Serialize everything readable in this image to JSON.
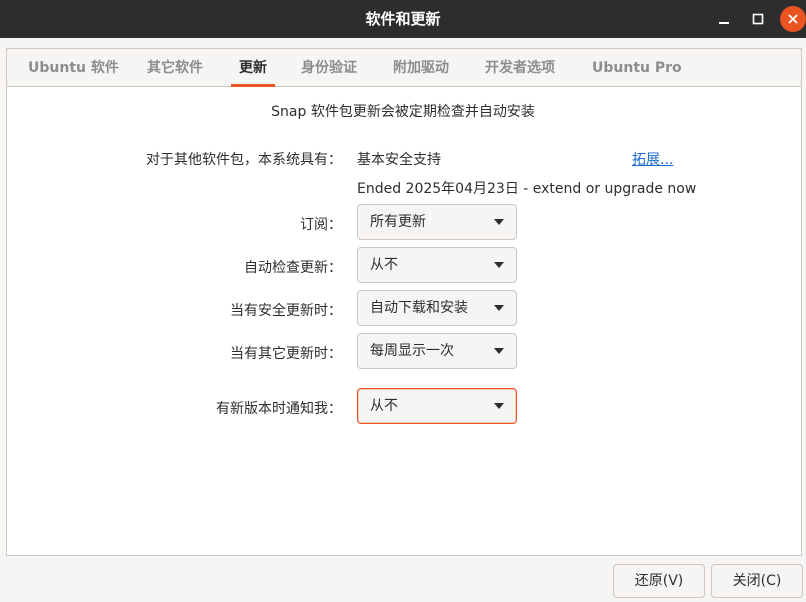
{
  "window": {
    "title": "软件和更新",
    "minimize_icon": "minimize-icon",
    "maximize_icon": "maximize-icon",
    "close_icon": "close-icon",
    "close_color": "#e95420"
  },
  "tabs": [
    {
      "label": "Ubuntu 软件",
      "active": false
    },
    {
      "label": "其它软件",
      "active": false
    },
    {
      "label": "更新",
      "active": true
    },
    {
      "label": "身份验证",
      "active": false
    },
    {
      "label": "附加驱动",
      "active": false
    },
    {
      "label": "开发者选项",
      "active": false
    },
    {
      "label": "Ubuntu Pro",
      "active": false
    }
  ],
  "updates": {
    "snap_note": "Snap 软件包更新会被定期检查并自动安装",
    "other_packages_label": "对于其他软件包，本系统具有：",
    "support_value": "基本安全支持",
    "expand_link": "拓展...",
    "support_status": "Ended 2025年04月23日 - extend or upgrade now",
    "subscribe_label": "订阅：",
    "subscribe_value": "所有更新",
    "auto_check_label": "自动检查更新：",
    "auto_check_value": "从不",
    "security_label": "当有安全更新时：",
    "security_value": "自动下载和安装",
    "other_updates_label": "当有其它更新时：",
    "other_updates_value": "每周显示一次",
    "notify_label": "有新版本时通知我：",
    "notify_value": "从不"
  },
  "buttons": {
    "revert": "还原(V)",
    "close": "关闭(C)"
  },
  "colors": {
    "accent": "#e95420",
    "link": "#1b6acb",
    "titlebar": "#2d2d2d"
  }
}
